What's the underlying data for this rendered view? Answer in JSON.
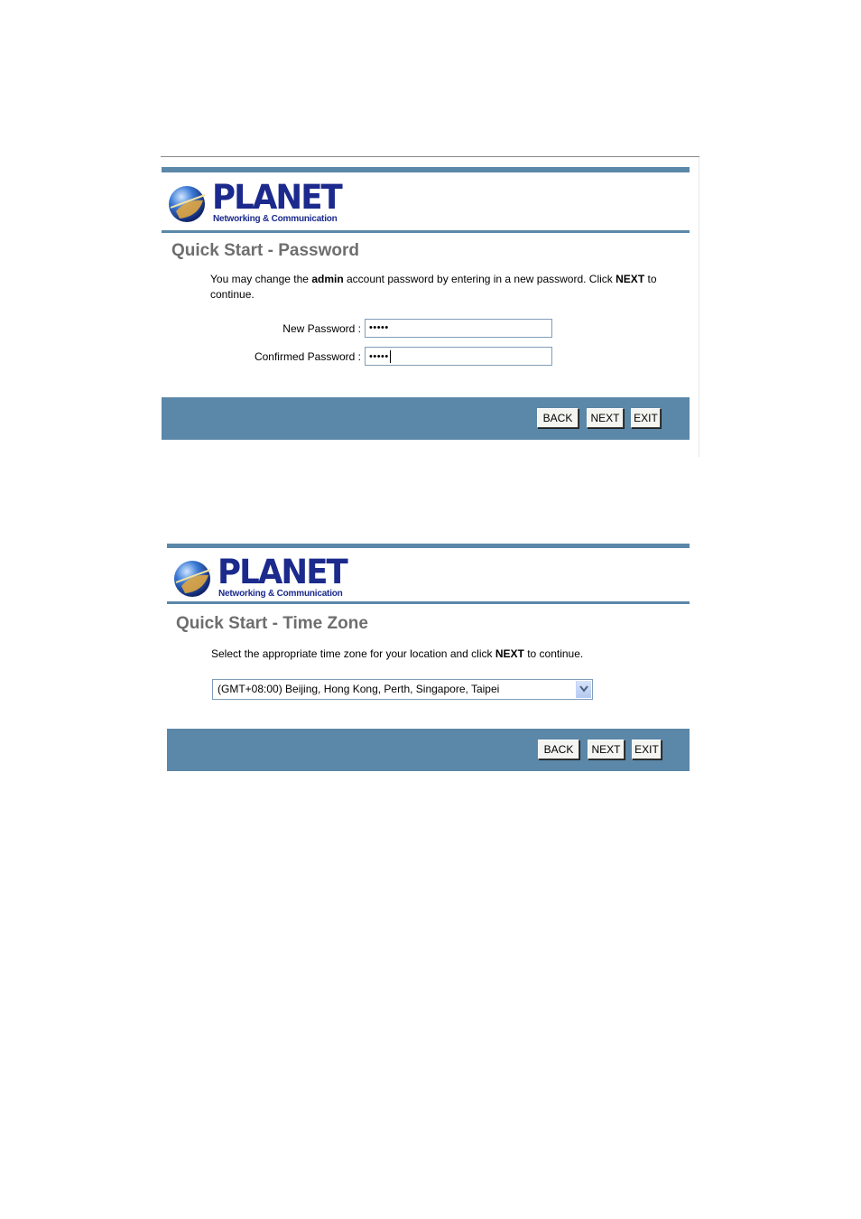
{
  "brand": {
    "name": "PLANET",
    "tagline": "Networking & Communication"
  },
  "password_step": {
    "title": "Quick Start - Password",
    "desc_part1": "You may change the ",
    "desc_bold1": "admin",
    "desc_part2": " account password by entering in a new password. Click ",
    "desc_bold2": "NEXT",
    "desc_part3": " to continue.",
    "new_password_label": "New Password :",
    "new_password_value": "•••••",
    "confirm_password_label": "Confirmed Password :",
    "confirm_password_value": "•••••",
    "buttons": {
      "back": "BACK",
      "next": "NEXT",
      "exit": "EXIT"
    }
  },
  "timezone_step": {
    "title": "Quick Start - Time Zone",
    "desc_part1": "Select the appropriate time zone for your location and click ",
    "desc_bold": "NEXT",
    "desc_part2": " to continue.",
    "selected_timezone": "(GMT+08:00) Beijing, Hong Kong, Perth, Singapore, Taipei",
    "buttons": {
      "back": "BACK",
      "next": "NEXT",
      "exit": "EXIT"
    }
  },
  "colors": {
    "band": "#5b87a8",
    "brand_blue": "#1b2a8c",
    "title_gray": "#6e6e6e"
  },
  "icons": [
    "planet-globe-icon",
    "chevron-down-icon"
  ]
}
